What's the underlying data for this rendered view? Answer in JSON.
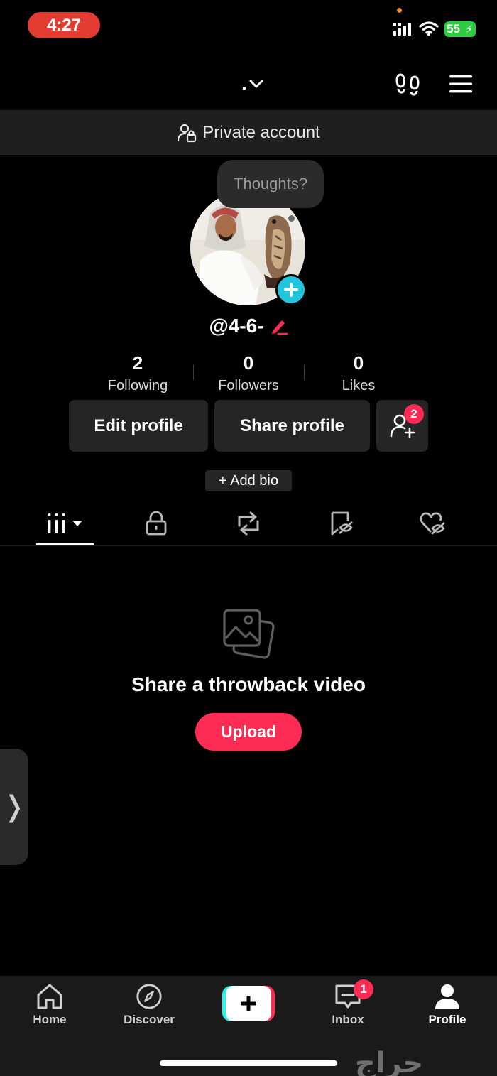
{
  "status_bar": {
    "time": "4:27",
    "battery": "55"
  },
  "header": {
    "account_handle": "."
  },
  "banner": {
    "text": "Private account"
  },
  "avatar": {
    "thought_bubble": "Thoughts?"
  },
  "profile": {
    "username": "@4-6-"
  },
  "stats": [
    {
      "value": "2",
      "label": "Following"
    },
    {
      "value": "0",
      "label": "Followers"
    },
    {
      "value": "0",
      "label": "Likes"
    }
  ],
  "actions": {
    "edit_profile": "Edit profile",
    "share_profile": "Share profile",
    "friends_badge": "2",
    "add_bio": "+ Add bio"
  },
  "empty_state": {
    "title": "Share a throwback video",
    "upload": "Upload"
  },
  "side_handle": "❭",
  "bottom_nav": {
    "home": "Home",
    "discover": "Discover",
    "inbox": "Inbox",
    "inbox_badge": "1",
    "profile": "Profile"
  },
  "watermark": "حراج",
  "colors": {
    "accent": "#fe2c55",
    "teal": "#20c5dd",
    "battery": "#2ecc40",
    "time_pill": "#e23b32"
  }
}
